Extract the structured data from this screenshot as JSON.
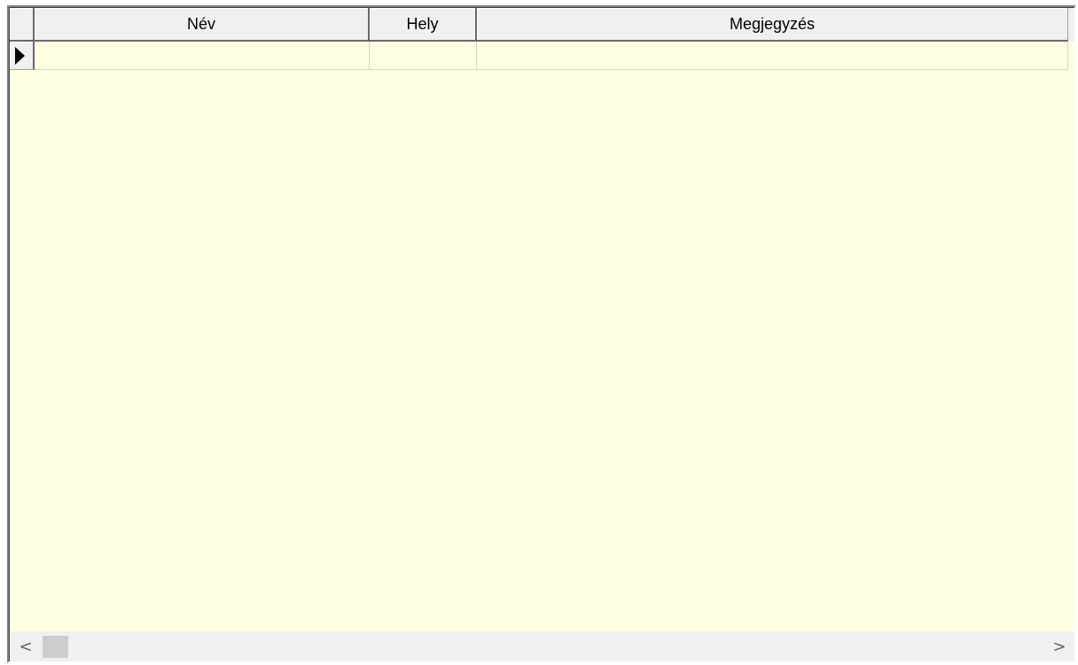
{
  "grid": {
    "columns": [
      {
        "key": "nev",
        "label": "Név"
      },
      {
        "key": "hely",
        "label": "Hely"
      },
      {
        "key": "megjegyzes",
        "label": "Megjegyzés"
      }
    ],
    "rows": [
      {
        "nev": "",
        "hely": "",
        "megjegyzes": "",
        "current": true
      }
    ],
    "background_color": "#ffffe1"
  },
  "scrollbar": {
    "left_icon": "chevron-left-icon",
    "right_icon": "chevron-right-icon",
    "left_glyph": "<",
    "right_glyph": ">",
    "position": 0
  }
}
